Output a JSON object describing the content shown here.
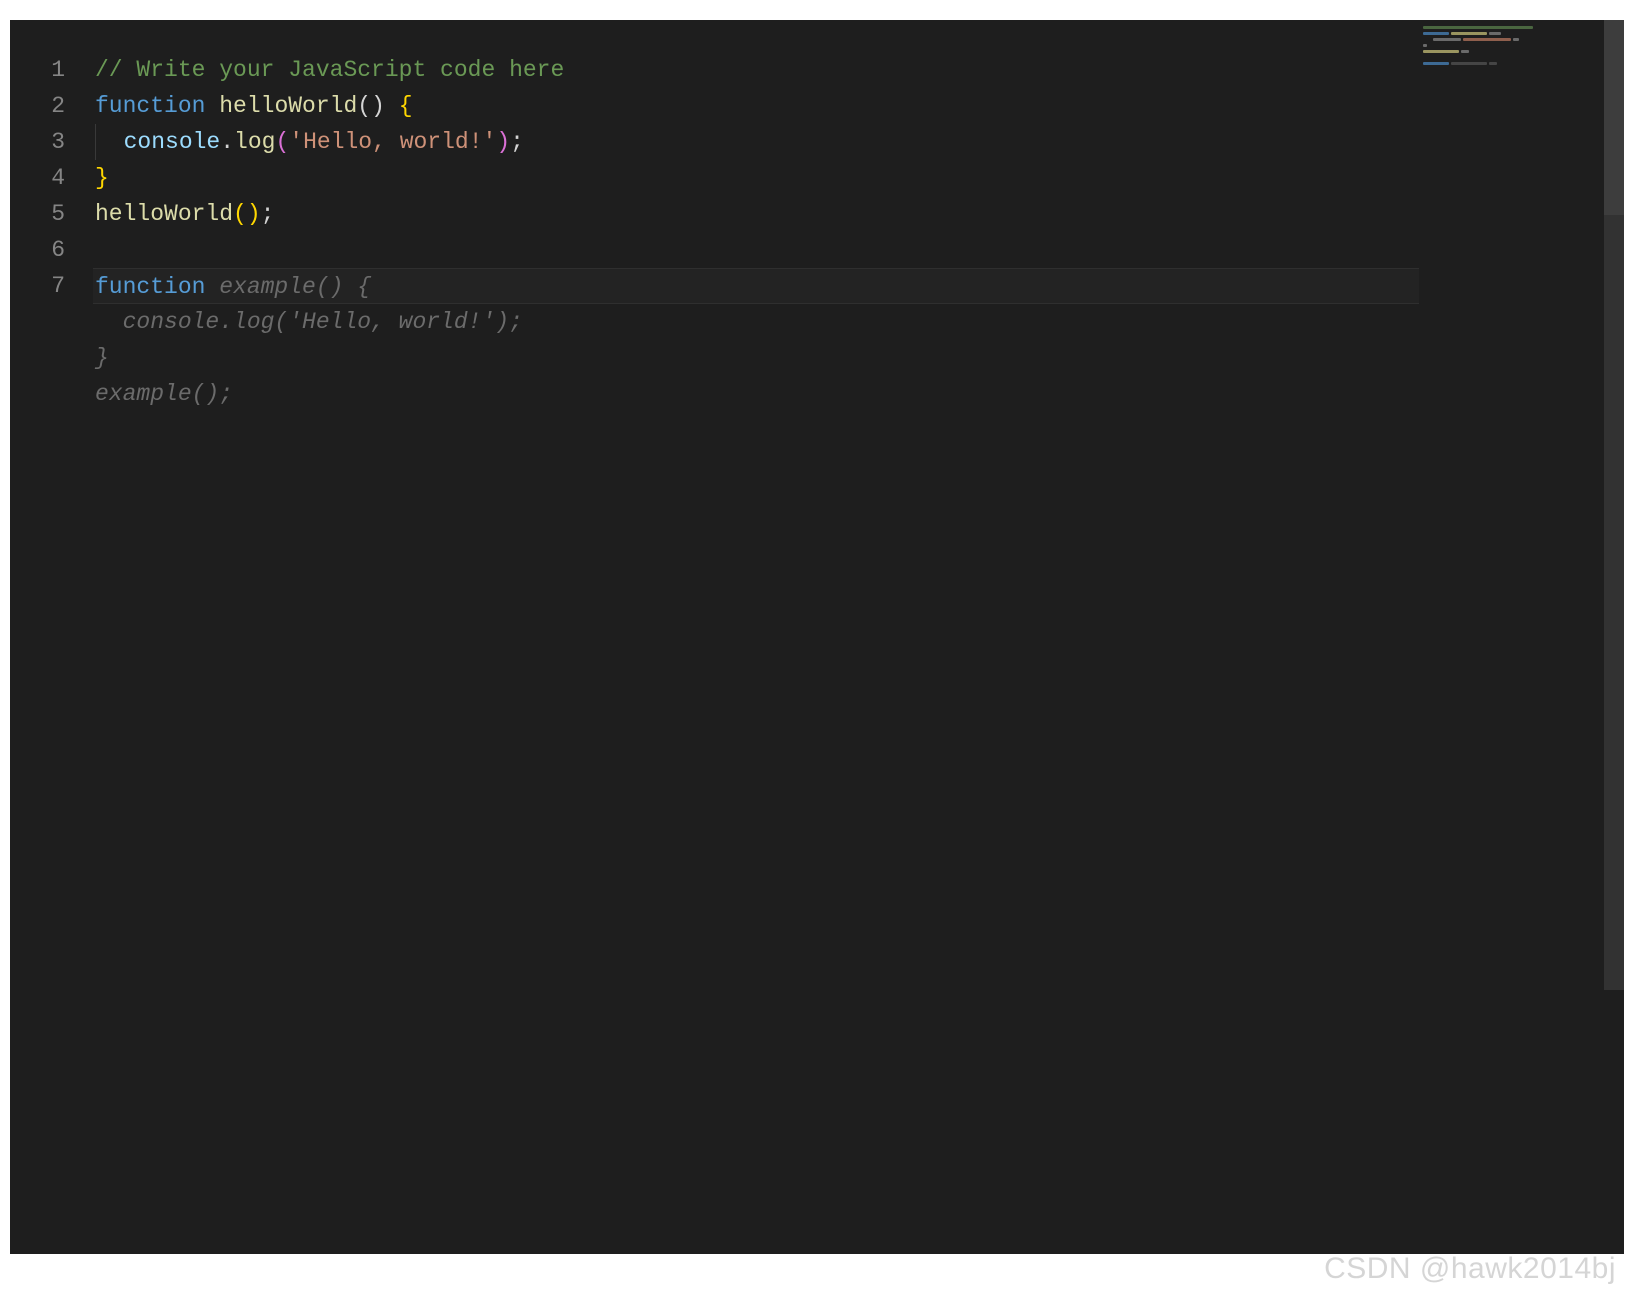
{
  "editor": {
    "lineNumbers": [
      "1",
      "2",
      "3",
      "4",
      "5",
      "6",
      "7"
    ],
    "currentLine": 7,
    "lines": {
      "l1": {
        "comment": "// Write your JavaScript code here"
      },
      "l2": {
        "keyword": "function",
        "space1": " ",
        "funcName": "helloWorld",
        "parenOpen": "(",
        "parenClose": ")",
        "space2": " ",
        "braceOpen": "{"
      },
      "l3": {
        "indent": "  ",
        "obj": "console",
        "dot": ".",
        "method": "log",
        "parenOpen": "(",
        "string": "'Hello, world!'",
        "parenClose": ")",
        "semi": ";"
      },
      "l4": {
        "braceClose": "}"
      },
      "l5": {
        "funcName": "helloWorld",
        "parenOpen": "(",
        "parenClose": ")",
        "semi": ";"
      },
      "l6": {
        "empty": ""
      },
      "l7": {
        "keyword": "function",
        "ghostRest": " example() {"
      }
    },
    "ghostLines": {
      "g1": "  console.log('Hello, world!');",
      "g2": "}",
      "g3": "example();"
    }
  },
  "watermark": "CSDN @hawk2014bj"
}
